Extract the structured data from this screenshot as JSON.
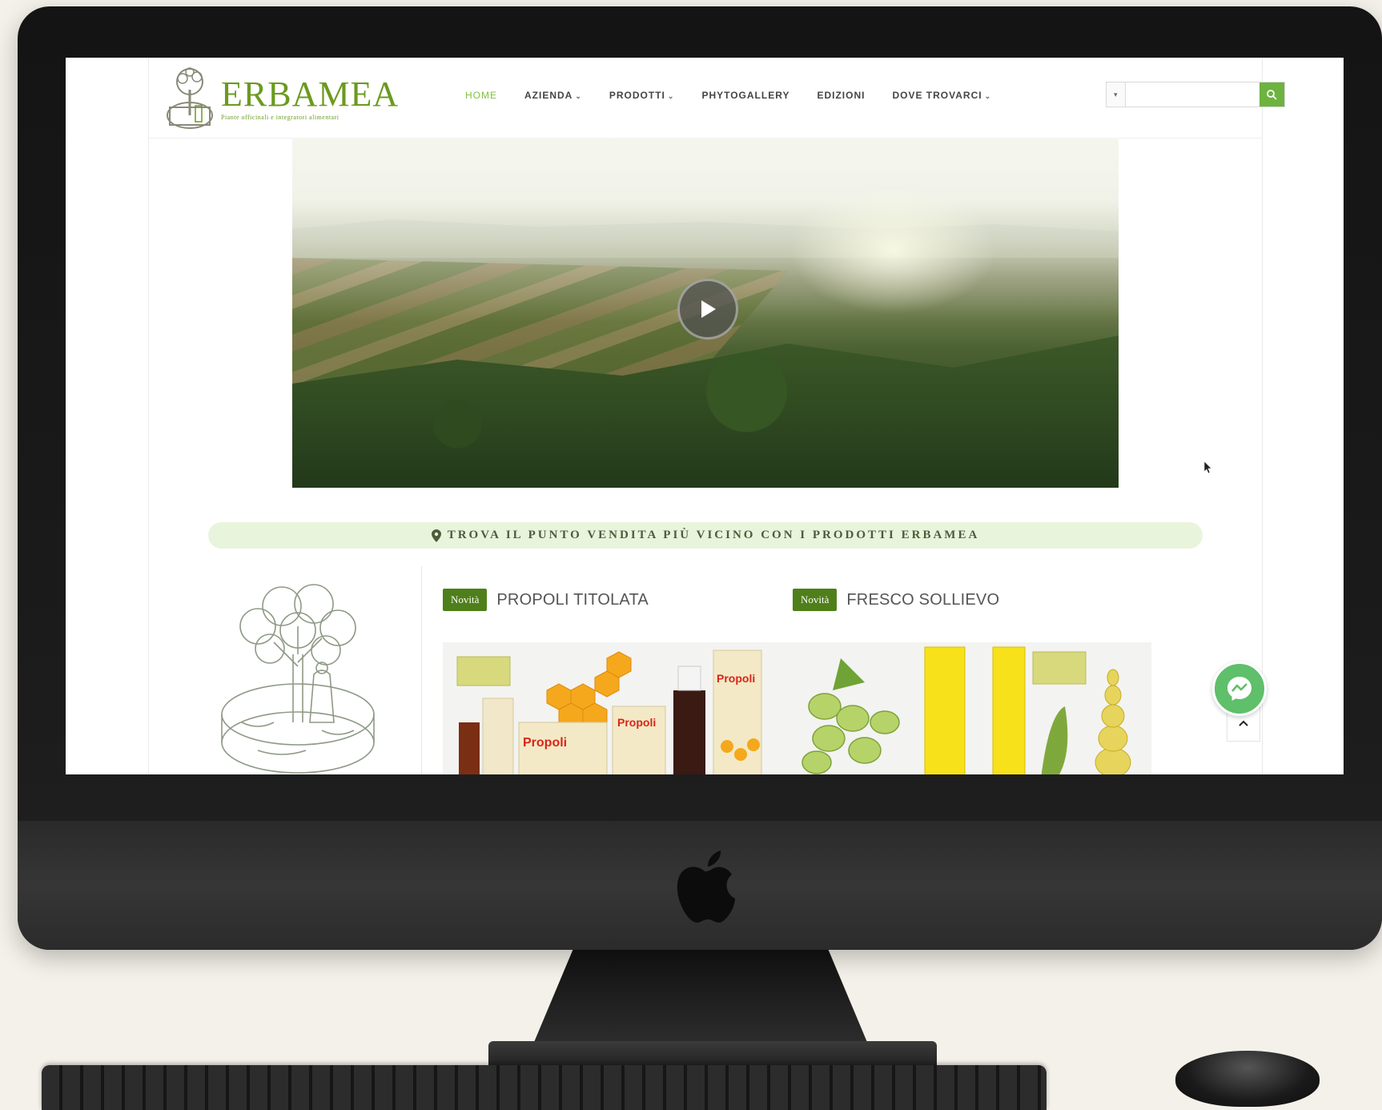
{
  "header": {
    "logo_name": "ERBAMEA",
    "logo_tagline": "Piante officinali e integratori alimentari",
    "nav": [
      {
        "label": "HOME",
        "active": true,
        "dropdown": false
      },
      {
        "label": "AZIENDA",
        "active": false,
        "dropdown": true
      },
      {
        "label": "PRODOTTI",
        "active": false,
        "dropdown": true
      },
      {
        "label": "PHYTOGALLERY",
        "active": false,
        "dropdown": false
      },
      {
        "label": "EDIZIONI",
        "active": false,
        "dropdown": false
      },
      {
        "label": "DOVE TROVARCI",
        "active": false,
        "dropdown": true
      }
    ],
    "search": {
      "placeholder": "",
      "value": ""
    }
  },
  "hero": {
    "type": "video",
    "play_icon": "play-icon"
  },
  "locator": {
    "text": "TROVA IL PUNTO VENDITA PIÙ VICINO CON I PRODOTTI ERBAMEA",
    "icon": "map-marker-icon"
  },
  "products": [
    {
      "badge": "Novità",
      "title": "PROPOLI TITOLATA"
    },
    {
      "badge": "Novità",
      "title": "FRESCO SOLLIEVO"
    }
  ],
  "colors": {
    "brand_green": "#6b9a1f",
    "nav_active": "#7fc13f",
    "badge_green": "#4f7f1a",
    "locator_bg": "#e9f4dc",
    "messenger": "#5fbf6a"
  },
  "widgets": {
    "scroll_top_icon": "chevron-up-icon",
    "chat_icon": "messenger-icon"
  }
}
